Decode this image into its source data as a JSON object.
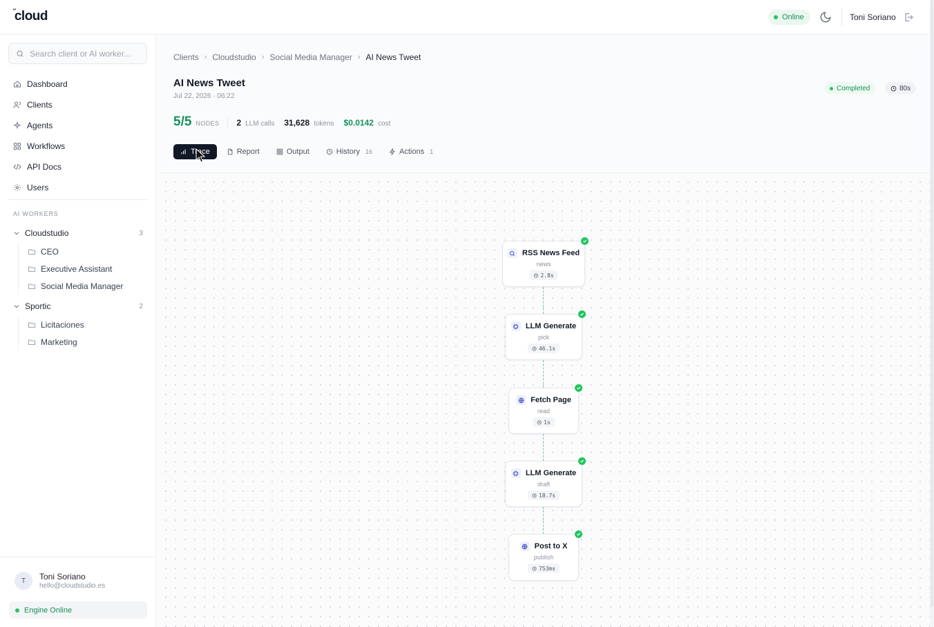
{
  "header": {
    "logo": "cloud",
    "status": "Online",
    "user_name": "Toni Soriano",
    "icons": [
      "moon-icon",
      "logout-icon"
    ]
  },
  "sidebar": {
    "search_placeholder": "Search client or AI worker...",
    "nav": [
      {
        "label": "Dashboard",
        "icon": "home-icon"
      },
      {
        "label": "Clients",
        "icon": "users-icon"
      },
      {
        "label": "Agents",
        "icon": "sparkle-icon"
      },
      {
        "label": "Workflows",
        "icon": "grid-icon"
      },
      {
        "label": "API Docs",
        "icon": "code-icon"
      },
      {
        "label": "Users",
        "icon": "gear-icon"
      }
    ],
    "section_title": "AI WORKERS",
    "groups": [
      {
        "name": "Cloudstudio",
        "count": "3",
        "children": [
          "CEO",
          "Executive Assistant",
          "Social Media Manager"
        ]
      },
      {
        "name": "Sportic",
        "count": "2",
        "children": [
          "Licitaciones",
          "Marketing"
        ]
      }
    ],
    "user": {
      "initial": "T",
      "name": "Toni Soriano",
      "email": "hello@cloudstudio.es"
    },
    "engine_status": "Engine Online"
  },
  "main": {
    "breadcrumbs": [
      "Clients",
      "Cloudstudio",
      "Social Media Manager",
      "AI News Tweet"
    ],
    "title": "AI News Tweet",
    "date": "Jul 22, 2026 · 06:22",
    "status": "Completed",
    "duration": "80s",
    "stats": {
      "nodes_value": "5/5",
      "nodes_label": "NODES",
      "llm_calls_value": "2",
      "llm_calls_label": "LLM calls",
      "tokens_value": "31,628",
      "tokens_label": "tokens",
      "cost_value": "$0.0142",
      "cost_label": "cost"
    },
    "tabs": [
      {
        "label": "Trace",
        "icon": "chart-icon",
        "badge": "",
        "active": true
      },
      {
        "label": "Report",
        "icon": "file-icon",
        "badge": "",
        "active": false
      },
      {
        "label": "Output",
        "icon": "grid-icon",
        "badge": "",
        "active": false
      },
      {
        "label": "History",
        "icon": "clock-icon",
        "badge": "16",
        "active": false
      },
      {
        "label": "Actions",
        "icon": "bolt-icon",
        "badge": "1",
        "active": false
      }
    ]
  },
  "trace": {
    "nodes": [
      {
        "title": "RSS News Feed",
        "sub": "news",
        "time": "2.8s",
        "icon": "search-icon"
      },
      {
        "title": "LLM Generate",
        "sub": "pick",
        "time": "46.1s",
        "icon": "cpu-icon"
      },
      {
        "title": "Fetch Page",
        "sub": "read",
        "time": "1s",
        "icon": "globe-icon"
      },
      {
        "title": "LLM Generate",
        "sub": "draft",
        "time": "18.7s",
        "icon": "cpu-icon"
      },
      {
        "title": "Post to X",
        "sub": "publish",
        "time": "753ms",
        "icon": "globe-icon"
      }
    ]
  },
  "colors": {
    "accent_green": "#15915a",
    "status_dot": "#22c55e",
    "tab_active_bg": "#111827",
    "edge": "#7fc4b2"
  }
}
